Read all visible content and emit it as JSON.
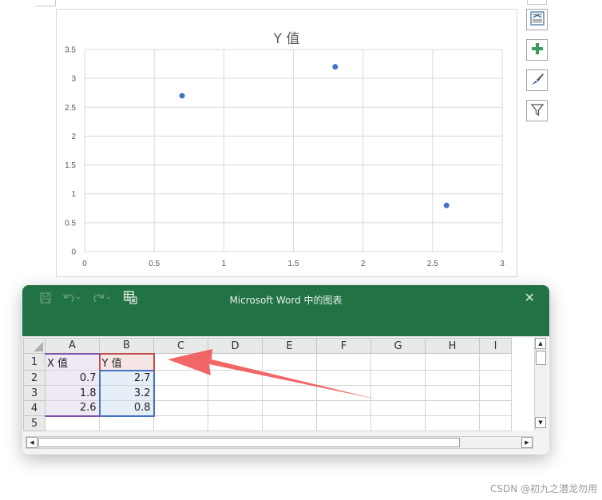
{
  "chart": {
    "title": "Y 值"
  },
  "chart_data": {
    "type": "scatter",
    "title": "Y 值",
    "xlabel": "",
    "ylabel": "",
    "x": [
      0.7,
      1.8,
      2.6
    ],
    "y": [
      2.7,
      3.2,
      0.8
    ],
    "xlim": [
      0,
      3
    ],
    "ylim": [
      0,
      3.5
    ],
    "x_ticks": [
      "0",
      "0.5",
      "1",
      "1.5",
      "2",
      "2.5",
      "3"
    ],
    "y_ticks": [
      "0",
      "0.5",
      "1",
      "1.5",
      "2",
      "2.5",
      "3",
      "3.5"
    ],
    "grid": true,
    "marker_color": "#4472c4"
  },
  "side_tools": {
    "layout_icon": "layout-options-icon",
    "elements_icon": "chart-elements-icon",
    "styles_icon": "chart-styles-icon",
    "filter_icon": "chart-filter-icon"
  },
  "excel": {
    "title": "Microsoft Word 中的图表",
    "close": "✕",
    "columns": [
      "A",
      "B",
      "C",
      "D",
      "E",
      "F",
      "G",
      "H",
      "I"
    ],
    "rows": [
      {
        "num": "1",
        "a": "X 值",
        "b": "Y 值"
      },
      {
        "num": "2",
        "a": "0.7",
        "b": "2.7"
      },
      {
        "num": "3",
        "a": "1.8",
        "b": "3.2"
      },
      {
        "num": "4",
        "a": "2.6",
        "b": "0.8"
      },
      {
        "num": "5",
        "a": "",
        "b": ""
      }
    ],
    "accent_color": "#217346"
  },
  "annotation": {
    "arrow_color": "#f05a5a"
  },
  "watermark": "CSDN @初九之潜龙勿用"
}
